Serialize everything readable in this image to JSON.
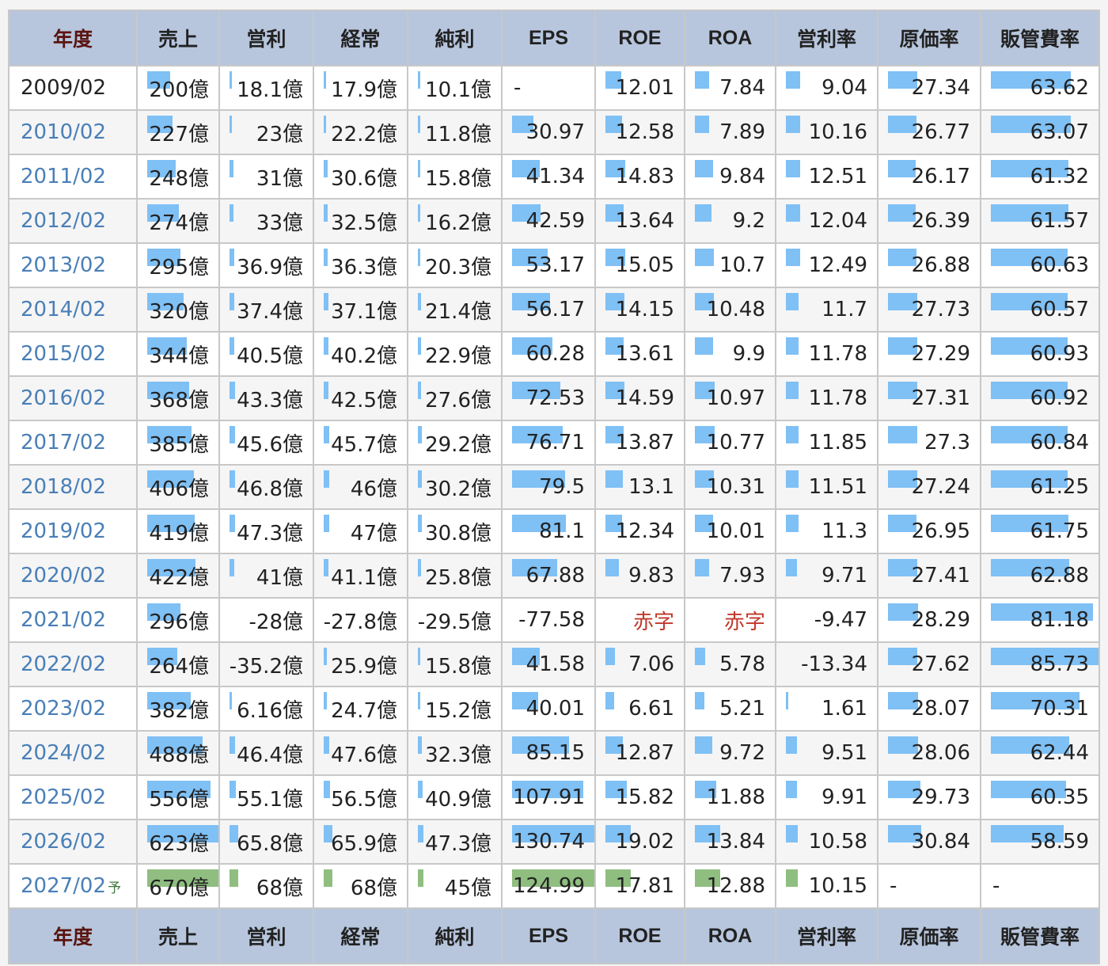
{
  "table": {
    "headers": [
      "年度",
      "売上",
      "営利",
      "経常",
      "純利",
      "EPS",
      "ROE",
      "ROA",
      "営利率",
      "原価率",
      "販管費率"
    ],
    "rows": [
      {
        "year": "2009/02",
        "suffix": "",
        "cells": [
          "200億",
          "18.1億",
          "17.9億",
          "10.1億",
          "-",
          "12.01",
          "7.84",
          "9.04",
          "27.34",
          "63.62"
        ],
        "bars": [
          0.32,
          0.03,
          0.03,
          0.02,
          0,
          0.2,
          0.18,
          0.16,
          0.32,
          0.74
        ]
      },
      {
        "year": "2010/02",
        "suffix": "",
        "cells": [
          "227億",
          "23億",
          "22.2億",
          "11.8億",
          "30.97",
          "12.58",
          "7.89",
          "10.16",
          "26.77",
          "63.07"
        ],
        "bars": [
          0.36,
          0.03,
          0.03,
          0.02,
          0.26,
          0.21,
          0.18,
          0.16,
          0.31,
          0.74
        ]
      },
      {
        "year": "2011/02",
        "suffix": "",
        "cells": [
          "248億",
          "31億",
          "30.6億",
          "15.8億",
          "41.34",
          "14.83",
          "9.84",
          "12.51",
          "26.17",
          "61.32"
        ],
        "bars": [
          0.4,
          0.05,
          0.05,
          0.03,
          0.34,
          0.25,
          0.23,
          0.16,
          0.3,
          0.72
        ]
      },
      {
        "year": "2012/02",
        "suffix": "",
        "cells": [
          "274億",
          "33億",
          "32.5億",
          "16.2億",
          "42.59",
          "13.64",
          "9.2",
          "12.04",
          "26.39",
          "61.57"
        ],
        "bars": [
          0.44,
          0.05,
          0.05,
          0.03,
          0.35,
          0.23,
          0.21,
          0.16,
          0.3,
          0.72
        ]
      },
      {
        "year": "2013/02",
        "suffix": "",
        "cells": [
          "295億",
          "36.9億",
          "36.3億",
          "20.3億",
          "53.17",
          "15.05",
          "10.7",
          "12.49",
          "26.88",
          "60.63"
        ],
        "bars": [
          0.47,
          0.06,
          0.05,
          0.03,
          0.43,
          0.25,
          0.24,
          0.16,
          0.31,
          0.71
        ]
      },
      {
        "year": "2014/02",
        "suffix": "",
        "cells": [
          "320億",
          "37.4億",
          "37.1億",
          "21.4億",
          "56.17",
          "14.15",
          "10.48",
          "11.7",
          "27.73",
          "60.57"
        ],
        "bars": [
          0.51,
          0.06,
          0.06,
          0.04,
          0.46,
          0.24,
          0.24,
          0.14,
          0.32,
          0.71
        ]
      },
      {
        "year": "2015/02",
        "suffix": "",
        "cells": [
          "344億",
          "40.5億",
          "40.2億",
          "22.9億",
          "60.28",
          "13.61",
          "9.9",
          "11.78",
          "27.29",
          "60.93"
        ],
        "bars": [
          0.55,
          0.06,
          0.06,
          0.04,
          0.49,
          0.23,
          0.23,
          0.14,
          0.32,
          0.71
        ]
      },
      {
        "year": "2016/02",
        "suffix": "",
        "cells": [
          "368億",
          "43.3億",
          "42.5億",
          "27.6億",
          "72.53",
          "14.59",
          "10.97",
          "11.78",
          "27.31",
          "60.92"
        ],
        "bars": [
          0.59,
          0.07,
          0.06,
          0.04,
          0.59,
          0.24,
          0.25,
          0.14,
          0.32,
          0.71
        ]
      },
      {
        "year": "2017/02",
        "suffix": "",
        "cells": [
          "385億",
          "45.6億",
          "45.7億",
          "29.2億",
          "76.71",
          "13.87",
          "10.77",
          "11.85",
          "27.3",
          "60.84"
        ],
        "bars": [
          0.62,
          0.07,
          0.07,
          0.05,
          0.62,
          0.23,
          0.25,
          0.14,
          0.32,
          0.71
        ]
      },
      {
        "year": "2018/02",
        "suffix": "",
        "cells": [
          "406億",
          "46.8億",
          "46億",
          "30.2億",
          "79.5",
          "13.1",
          "10.31",
          "11.51",
          "27.24",
          "61.25"
        ],
        "bars": [
          0.65,
          0.07,
          0.07,
          0.05,
          0.64,
          0.22,
          0.24,
          0.14,
          0.32,
          0.71
        ]
      },
      {
        "year": "2019/02",
        "suffix": "",
        "cells": [
          "419億",
          "47.3億",
          "47億",
          "30.8億",
          "81.1",
          "12.34",
          "10.01",
          "11.3",
          "26.95",
          "61.75"
        ],
        "bars": [
          0.67,
          0.07,
          0.07,
          0.05,
          0.65,
          0.21,
          0.23,
          0.14,
          0.31,
          0.72
        ]
      },
      {
        "year": "2020/02",
        "suffix": "",
        "cells": [
          "422億",
          "41億",
          "41.1億",
          "25.8億",
          "67.88",
          "9.83",
          "7.93",
          "9.71",
          "27.41",
          "62.88"
        ],
        "bars": [
          0.68,
          0.06,
          0.06,
          0.04,
          0.55,
          0.17,
          0.18,
          0.12,
          0.32,
          0.73
        ]
      },
      {
        "year": "2021/02",
        "suffix": "",
        "cells": [
          "296億",
          "-28億",
          "-27.8億",
          "-29.5億",
          "-77.58",
          "赤字",
          "赤字",
          "-9.47",
          "28.29",
          "81.18"
        ],
        "bars": [
          0.47,
          0,
          0,
          0,
          0,
          0,
          0,
          0,
          0.33,
          0.95
        ]
      },
      {
        "year": "2022/02",
        "suffix": "",
        "cells": [
          "264億",
          "-35.2億",
          "25.9億",
          "15.8億",
          "41.58",
          "7.06",
          "5.78",
          "-13.34",
          "27.62",
          "85.73"
        ],
        "bars": [
          0.42,
          0,
          0.04,
          0.03,
          0.34,
          0.12,
          0.13,
          0,
          0.32,
          1.0
        ]
      },
      {
        "year": "2023/02",
        "suffix": "",
        "cells": [
          "382億",
          "6.16億",
          "24.7億",
          "15.2億",
          "40.01",
          "6.61",
          "5.21",
          "1.61",
          "28.07",
          "70.31"
        ],
        "bars": [
          0.61,
          0.01,
          0.04,
          0.02,
          0.32,
          0.11,
          0.12,
          0.02,
          0.33,
          0.82
        ]
      },
      {
        "year": "2024/02",
        "suffix": "",
        "cells": [
          "488億",
          "46.4億",
          "47.6億",
          "32.3億",
          "85.15",
          "12.87",
          "9.72",
          "9.51",
          "28.06",
          "62.44"
        ],
        "bars": [
          0.78,
          0.07,
          0.07,
          0.05,
          0.69,
          0.22,
          0.22,
          0.12,
          0.33,
          0.73
        ]
      },
      {
        "year": "2025/02",
        "suffix": "",
        "cells": [
          "556億",
          "55.1億",
          "56.5億",
          "40.9億",
          "107.91",
          "15.82",
          "11.88",
          "9.91",
          "29.73",
          "60.35"
        ],
        "bars": [
          0.89,
          0.08,
          0.08,
          0.06,
          0.87,
          0.27,
          0.27,
          0.12,
          0.35,
          0.7
        ]
      },
      {
        "year": "2026/02",
        "suffix": "",
        "cells": [
          "623億",
          "65.8億",
          "65.9億",
          "47.3億",
          "130.74",
          "19.02",
          "13.84",
          "10.58",
          "30.84",
          "58.59"
        ],
        "bars": [
          1.0,
          0.1,
          0.1,
          0.07,
          1.0,
          0.32,
          0.32,
          0.13,
          0.36,
          0.68
        ]
      },
      {
        "year": "2027/02",
        "suffix": "予",
        "cells": [
          "670億",
          "68億",
          "68億",
          "45億",
          "124.99",
          "17.81",
          "12.88",
          "10.15",
          "-",
          "-"
        ],
        "bars": [
          1.0,
          0.1,
          0.1,
          0.07,
          1.0,
          0.32,
          0.32,
          0.13,
          0,
          0
        ],
        "predicted": true
      }
    ]
  }
}
